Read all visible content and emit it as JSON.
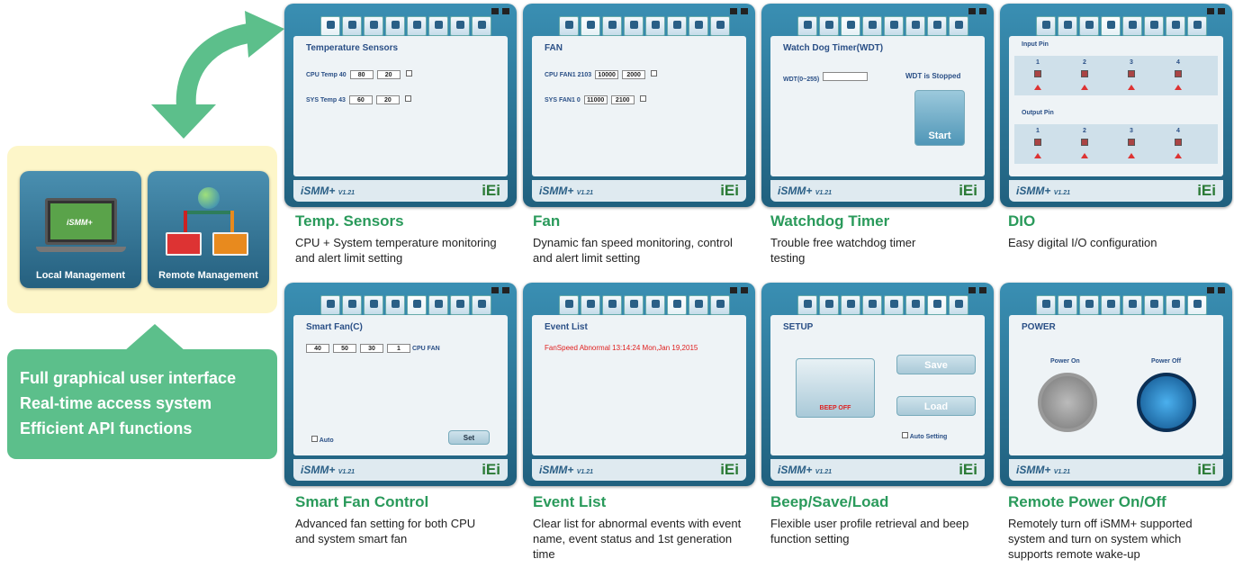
{
  "left": {
    "tiles": {
      "local": "Local Management",
      "remote": "Remote Management"
    },
    "laptop_logo": "iSMM+",
    "features": [
      "Full graphical user interface",
      "Real-time access system",
      "Efficient API functions"
    ]
  },
  "common": {
    "logo": "iSMM+",
    "version": "V1.21",
    "brand": "iEi"
  },
  "screens": {
    "temp": {
      "title": "Temperature Sensors",
      "rows": [
        {
          "label": "CPU Temp",
          "value": "40",
          "high": "80",
          "low": "20"
        },
        {
          "label": "SYS Temp",
          "value": "43",
          "high": "60",
          "low": "20"
        }
      ]
    },
    "fan": {
      "title": "FAN",
      "rows": [
        {
          "label": "CPU FAN1",
          "value": "2103",
          "high": "10000",
          "low": "2000"
        },
        {
          "label": "SYS FAN1",
          "value": "0",
          "high": "11000",
          "low": "2100"
        }
      ]
    },
    "wdt": {
      "title": "Watch Dog Timer(WDT)",
      "range": "WDT(0~255)",
      "status": "WDT is Stopped",
      "start": "Start"
    },
    "dio": {
      "input": "Input Pin",
      "output": "Output Pin",
      "pins": [
        "1",
        "2",
        "3",
        "4"
      ]
    },
    "smartfan": {
      "title": "Smart Fan(C)",
      "step": "40",
      "start": "50",
      "duty": "30",
      "slope": "1",
      "cpu_fan": "CPU FAN",
      "auto": "Auto",
      "set": "Set"
    },
    "event": {
      "title": "Event List",
      "entry": "FanSpeed Abnormal 13:14:24 Mon,Jan 19,2015"
    },
    "setup": {
      "title": "SETUP",
      "save": "Save",
      "load": "Load",
      "beep": "BEEP OFF",
      "auto": "Auto Setting"
    },
    "power": {
      "title": "POWER",
      "on": "Power On",
      "off": "Power Off"
    }
  },
  "captions": [
    {
      "title": "Temp. Sensors",
      "desc": "CPU + System temperature monitoring and alert limit setting"
    },
    {
      "title": "Fan",
      "desc": "Dynamic fan speed monitoring, control and alert limit setting"
    },
    {
      "title": "Watchdog Timer",
      "desc": "Trouble free watchdog timer testing"
    },
    {
      "title": "DIO",
      "desc": "Easy digital I/O configuration"
    },
    {
      "title": "Smart Fan Control",
      "desc": "Advanced fan setting for both CPU and system smart fan"
    },
    {
      "title": "Event List",
      "desc": "Clear list for abnormal events with event name, event status and 1st generation time"
    },
    {
      "title": "Beep/Save/Load",
      "desc": "Flexible user profile retrieval and beep function setting"
    },
    {
      "title": "Remote Power On/Off",
      "desc": "Remotely turn off iSMM+ supported system and turn on system which supports remote wake-up"
    }
  ],
  "colors": {
    "accent": "#2a9a5b",
    "panel": "#fdf6c9",
    "tile": "#25607f",
    "feature_box": "#5cbf8b"
  }
}
